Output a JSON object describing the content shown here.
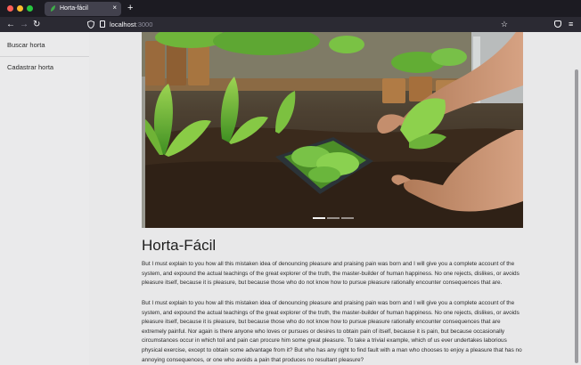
{
  "browser": {
    "tab": {
      "title": "Horta-fácil",
      "close": "×"
    },
    "new_tab": "+",
    "nav": {
      "back": "←",
      "forward": "→",
      "reload": "↻"
    },
    "url": {
      "host": "localhost",
      "port": ":3000"
    },
    "bookmark": "☆",
    "menu": "≡"
  },
  "sidebar": {
    "items": [
      {
        "label": "Buscar horta"
      },
      {
        "label": "Cadastrar horta"
      }
    ]
  },
  "main": {
    "carousel": {
      "slide_count": 3,
      "active_index": 0
    },
    "title": "Horta-Fácil",
    "paragraphs": [
      "But I must explain to you how all this mistaken idea of denouncing pleasure and praising pain was born and I will give you a complete account of the system, and expound the actual teachings of the great explorer of the truth, the master-builder of human happiness. No one rejects, dislikes, or avoids pleasure itself, because it is pleasure, but because those who do not know how to pursue pleasure rationally encounter consequences that are.",
      "But I must explain to you how all this mistaken idea of denouncing pleasure and praising pain was born and I will give you a complete account of the system, and expound the actual teachings of the great explorer of the truth, the master-builder of human happiness. No one rejects, dislikes, or avoids pleasure itself, because it is pleasure, but because those who do not know how to pursue pleasure rationally encounter consequences that are extremely painful. Nor again is there anyone who loves or pursues or desires to obtain pain of itself, because it is pain, but because occasionally circumstances occur in which toil and pain can procure him some great pleasure. To take a trivial example, which of us ever undertakes laborious physical exercise, except to obtain some advantage from it? But who has any right to find fault with a man who chooses to enjoy a pleasure that has no annoying consequences, or one who avoids a pain that produces no resultant pleasure?"
    ]
  }
}
